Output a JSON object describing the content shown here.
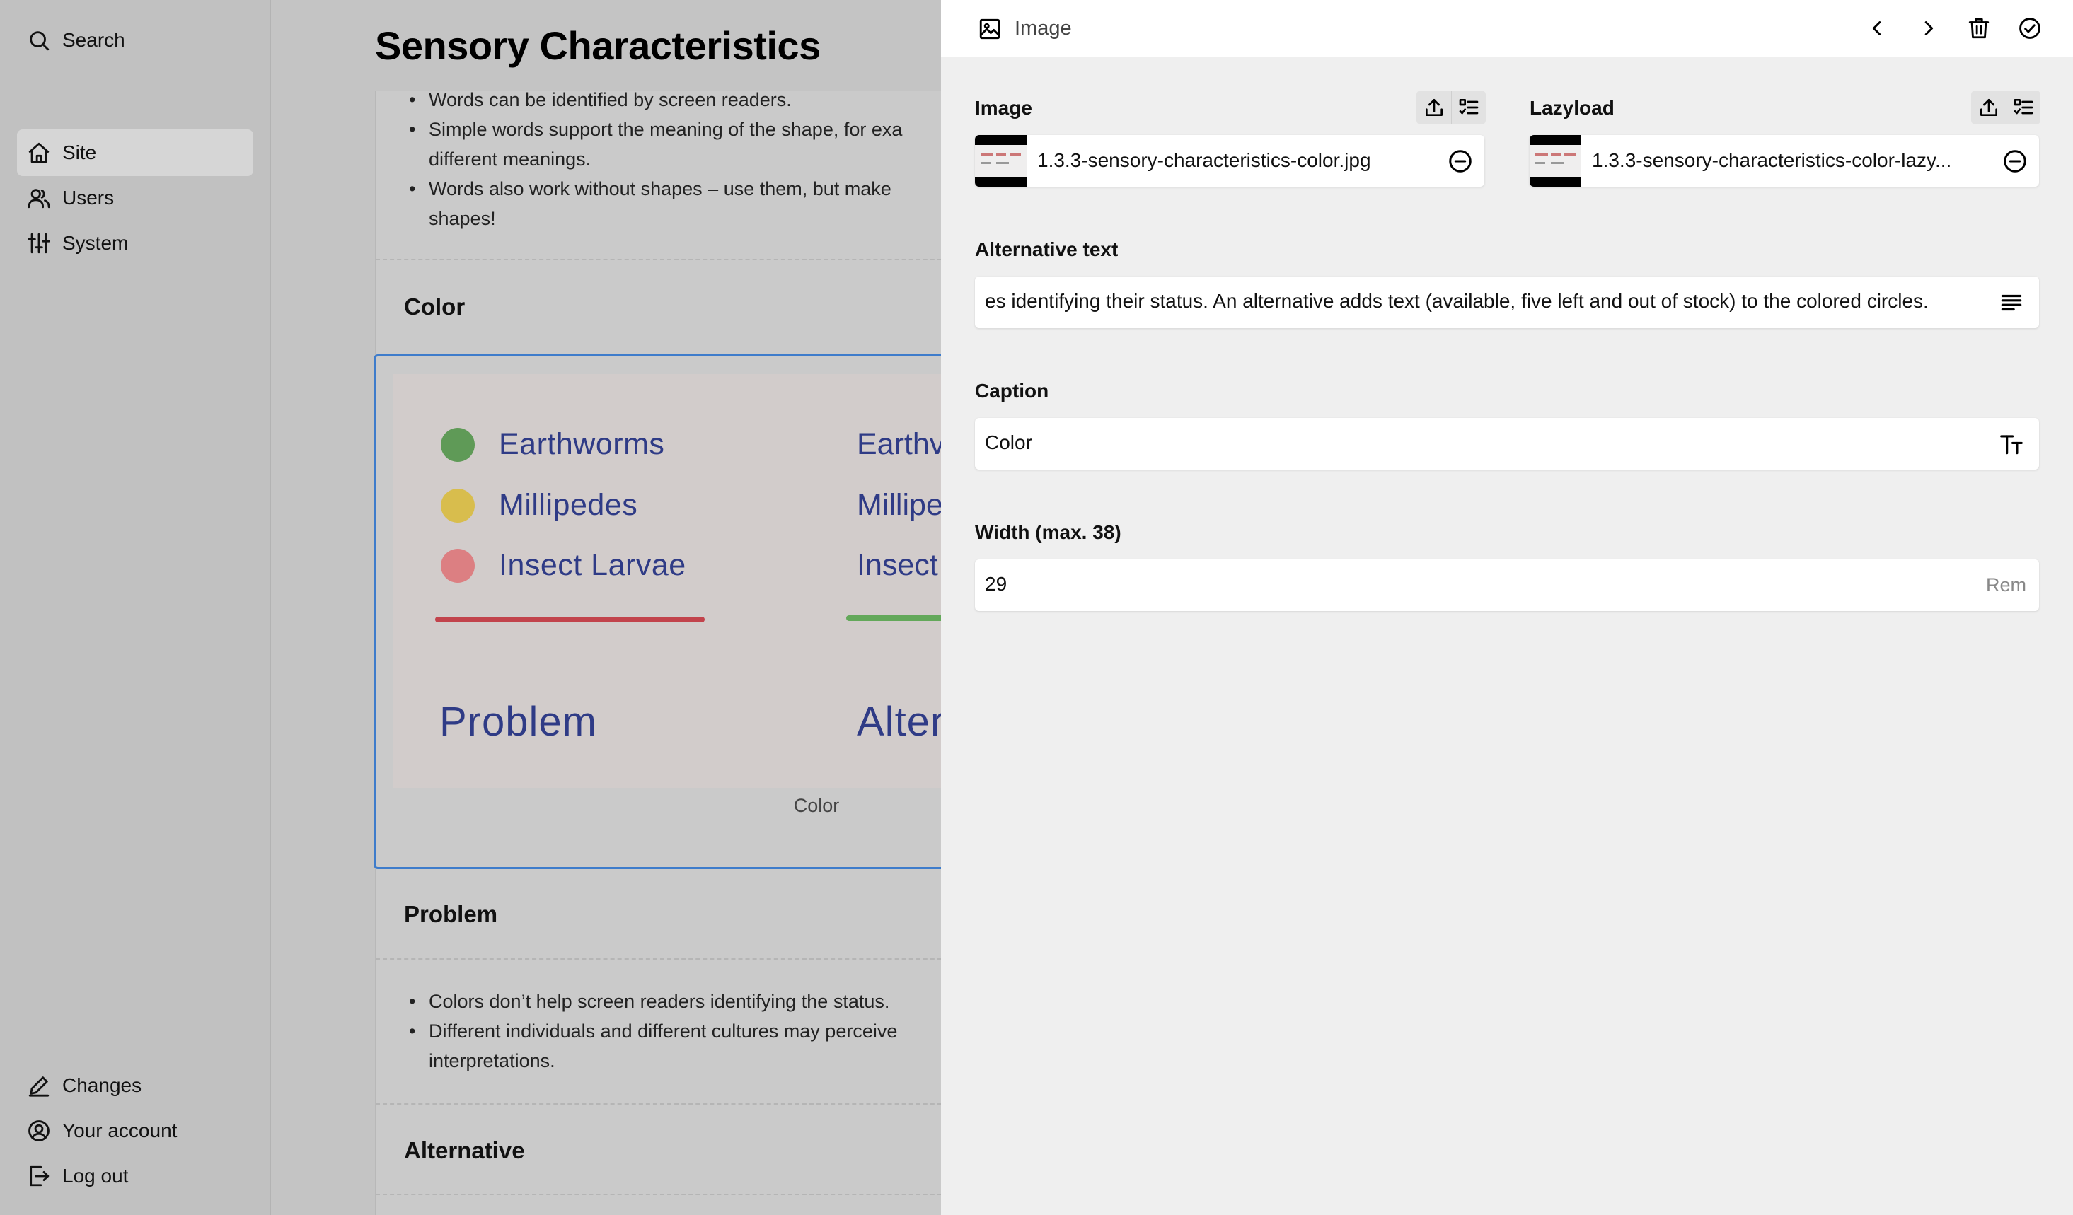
{
  "sidebar": {
    "search_label": "Search",
    "menu": [
      {
        "label": "Site",
        "icon": "home-icon",
        "active": true
      },
      {
        "label": "Users",
        "icon": "users-icon",
        "active": false
      },
      {
        "label": "System",
        "icon": "settings-sliders-icon",
        "active": false
      }
    ],
    "bottom": [
      {
        "label": "Changes",
        "icon": "pencil-icon"
      },
      {
        "label": "Your account",
        "icon": "account-icon"
      },
      {
        "label": "Log out",
        "icon": "logout-icon"
      }
    ]
  },
  "content": {
    "page_title": "Sensory Characteristics",
    "intro_list": [
      "Words can be identified by screen readers.",
      "Simple words support the meaning of the shape, for exa",
      "different meanings.",
      "Words also work without shapes – use them, but make",
      "shapes!"
    ],
    "heading_color": "Color",
    "image": {
      "legend": [
        "Earthworms",
        "Millipedes",
        "Insect Larvae"
      ],
      "legend_colors": [
        "#5f9a57",
        "#d8bd4d",
        "#dc7f82"
      ],
      "alt_labels": [
        "Earthv",
        "Millipe",
        "Insect"
      ],
      "problem_label": "Problem",
      "alternative_label": "Alter",
      "caption": "Color"
    },
    "heading_problem": "Problem",
    "problem_list": [
      "Colors don’t help screen readers identifying the status.",
      "Different individuals and different cultures may perceive",
      "interpretations."
    ],
    "heading_alternative": "Alternative"
  },
  "panel": {
    "title": "Image",
    "image_field": {
      "label": "Image",
      "filename": "1.3.3-sensory-characteristics-color.jpg"
    },
    "lazyload_field": {
      "label": "Lazyload",
      "filename": "1.3.3-sensory-characteristics-color-lazy..."
    },
    "alt_text": {
      "label": "Alternative text",
      "value": "es identifying their status. An alternative adds text (available, five left and out of stock) to the colored circles."
    },
    "caption": {
      "label": "Caption",
      "value": "Color"
    },
    "width": {
      "label": "Width (max. 38)",
      "value": "29",
      "unit": "Rem"
    }
  }
}
